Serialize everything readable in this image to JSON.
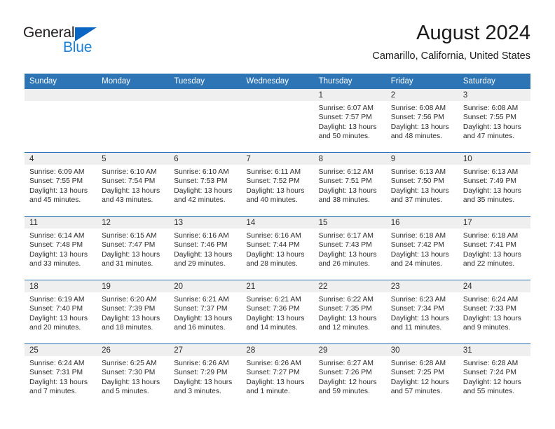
{
  "logo": {
    "word1": "General",
    "word2": "Blue",
    "triangle_color": "#0a66c2",
    "word2_color": "#1d81d7"
  },
  "header": {
    "month_title": "August 2024",
    "location": "Camarillo, California, United States"
  },
  "theme": {
    "header_bg": "#2e75b6",
    "header_text": "#ffffff",
    "daynum_band_bg": "#efefef",
    "row_separator": "#2e75b6",
    "cell_bg": "#ffffff",
    "text": "#2b2b2b"
  },
  "weekday_headers": [
    "Sunday",
    "Monday",
    "Tuesday",
    "Wednesday",
    "Thursday",
    "Friday",
    "Saturday"
  ],
  "weeks": [
    [
      {
        "day": "",
        "empty": true,
        "sunrise": "",
        "sunset": "",
        "daylight_line1": "",
        "daylight_line2": ""
      },
      {
        "day": "",
        "empty": true,
        "sunrise": "",
        "sunset": "",
        "daylight_line1": "",
        "daylight_line2": ""
      },
      {
        "day": "",
        "empty": true,
        "sunrise": "",
        "sunset": "",
        "daylight_line1": "",
        "daylight_line2": ""
      },
      {
        "day": "",
        "empty": true,
        "sunrise": "",
        "sunset": "",
        "daylight_line1": "",
        "daylight_line2": ""
      },
      {
        "day": "1",
        "empty": false,
        "sunrise": "Sunrise: 6:07 AM",
        "sunset": "Sunset: 7:57 PM",
        "daylight_line1": "Daylight: 13 hours",
        "daylight_line2": "and 50 minutes."
      },
      {
        "day": "2",
        "empty": false,
        "sunrise": "Sunrise: 6:08 AM",
        "sunset": "Sunset: 7:56 PM",
        "daylight_line1": "Daylight: 13 hours",
        "daylight_line2": "and 48 minutes."
      },
      {
        "day": "3",
        "empty": false,
        "sunrise": "Sunrise: 6:08 AM",
        "sunset": "Sunset: 7:55 PM",
        "daylight_line1": "Daylight: 13 hours",
        "daylight_line2": "and 47 minutes."
      }
    ],
    [
      {
        "day": "4",
        "empty": false,
        "sunrise": "Sunrise: 6:09 AM",
        "sunset": "Sunset: 7:55 PM",
        "daylight_line1": "Daylight: 13 hours",
        "daylight_line2": "and 45 minutes."
      },
      {
        "day": "5",
        "empty": false,
        "sunrise": "Sunrise: 6:10 AM",
        "sunset": "Sunset: 7:54 PM",
        "daylight_line1": "Daylight: 13 hours",
        "daylight_line2": "and 43 minutes."
      },
      {
        "day": "6",
        "empty": false,
        "sunrise": "Sunrise: 6:10 AM",
        "sunset": "Sunset: 7:53 PM",
        "daylight_line1": "Daylight: 13 hours",
        "daylight_line2": "and 42 minutes."
      },
      {
        "day": "7",
        "empty": false,
        "sunrise": "Sunrise: 6:11 AM",
        "sunset": "Sunset: 7:52 PM",
        "daylight_line1": "Daylight: 13 hours",
        "daylight_line2": "and 40 minutes."
      },
      {
        "day": "8",
        "empty": false,
        "sunrise": "Sunrise: 6:12 AM",
        "sunset": "Sunset: 7:51 PM",
        "daylight_line1": "Daylight: 13 hours",
        "daylight_line2": "and 38 minutes."
      },
      {
        "day": "9",
        "empty": false,
        "sunrise": "Sunrise: 6:13 AM",
        "sunset": "Sunset: 7:50 PM",
        "daylight_line1": "Daylight: 13 hours",
        "daylight_line2": "and 37 minutes."
      },
      {
        "day": "10",
        "empty": false,
        "sunrise": "Sunrise: 6:13 AM",
        "sunset": "Sunset: 7:49 PM",
        "daylight_line1": "Daylight: 13 hours",
        "daylight_line2": "and 35 minutes."
      }
    ],
    [
      {
        "day": "11",
        "empty": false,
        "sunrise": "Sunrise: 6:14 AM",
        "sunset": "Sunset: 7:48 PM",
        "daylight_line1": "Daylight: 13 hours",
        "daylight_line2": "and 33 minutes."
      },
      {
        "day": "12",
        "empty": false,
        "sunrise": "Sunrise: 6:15 AM",
        "sunset": "Sunset: 7:47 PM",
        "daylight_line1": "Daylight: 13 hours",
        "daylight_line2": "and 31 minutes."
      },
      {
        "day": "13",
        "empty": false,
        "sunrise": "Sunrise: 6:16 AM",
        "sunset": "Sunset: 7:46 PM",
        "daylight_line1": "Daylight: 13 hours",
        "daylight_line2": "and 29 minutes."
      },
      {
        "day": "14",
        "empty": false,
        "sunrise": "Sunrise: 6:16 AM",
        "sunset": "Sunset: 7:44 PM",
        "daylight_line1": "Daylight: 13 hours",
        "daylight_line2": "and 28 minutes."
      },
      {
        "day": "15",
        "empty": false,
        "sunrise": "Sunrise: 6:17 AM",
        "sunset": "Sunset: 7:43 PM",
        "daylight_line1": "Daylight: 13 hours",
        "daylight_line2": "and 26 minutes."
      },
      {
        "day": "16",
        "empty": false,
        "sunrise": "Sunrise: 6:18 AM",
        "sunset": "Sunset: 7:42 PM",
        "daylight_line1": "Daylight: 13 hours",
        "daylight_line2": "and 24 minutes."
      },
      {
        "day": "17",
        "empty": false,
        "sunrise": "Sunrise: 6:18 AM",
        "sunset": "Sunset: 7:41 PM",
        "daylight_line1": "Daylight: 13 hours",
        "daylight_line2": "and 22 minutes."
      }
    ],
    [
      {
        "day": "18",
        "empty": false,
        "sunrise": "Sunrise: 6:19 AM",
        "sunset": "Sunset: 7:40 PM",
        "daylight_line1": "Daylight: 13 hours",
        "daylight_line2": "and 20 minutes."
      },
      {
        "day": "19",
        "empty": false,
        "sunrise": "Sunrise: 6:20 AM",
        "sunset": "Sunset: 7:39 PM",
        "daylight_line1": "Daylight: 13 hours",
        "daylight_line2": "and 18 minutes."
      },
      {
        "day": "20",
        "empty": false,
        "sunrise": "Sunrise: 6:21 AM",
        "sunset": "Sunset: 7:37 PM",
        "daylight_line1": "Daylight: 13 hours",
        "daylight_line2": "and 16 minutes."
      },
      {
        "day": "21",
        "empty": false,
        "sunrise": "Sunrise: 6:21 AM",
        "sunset": "Sunset: 7:36 PM",
        "daylight_line1": "Daylight: 13 hours",
        "daylight_line2": "and 14 minutes."
      },
      {
        "day": "22",
        "empty": false,
        "sunrise": "Sunrise: 6:22 AM",
        "sunset": "Sunset: 7:35 PM",
        "daylight_line1": "Daylight: 13 hours",
        "daylight_line2": "and 12 minutes."
      },
      {
        "day": "23",
        "empty": false,
        "sunrise": "Sunrise: 6:23 AM",
        "sunset": "Sunset: 7:34 PM",
        "daylight_line1": "Daylight: 13 hours",
        "daylight_line2": "and 11 minutes."
      },
      {
        "day": "24",
        "empty": false,
        "sunrise": "Sunrise: 6:24 AM",
        "sunset": "Sunset: 7:33 PM",
        "daylight_line1": "Daylight: 13 hours",
        "daylight_line2": "and 9 minutes."
      }
    ],
    [
      {
        "day": "25",
        "empty": false,
        "sunrise": "Sunrise: 6:24 AM",
        "sunset": "Sunset: 7:31 PM",
        "daylight_line1": "Daylight: 13 hours",
        "daylight_line2": "and 7 minutes."
      },
      {
        "day": "26",
        "empty": false,
        "sunrise": "Sunrise: 6:25 AM",
        "sunset": "Sunset: 7:30 PM",
        "daylight_line1": "Daylight: 13 hours",
        "daylight_line2": "and 5 minutes."
      },
      {
        "day": "27",
        "empty": false,
        "sunrise": "Sunrise: 6:26 AM",
        "sunset": "Sunset: 7:29 PM",
        "daylight_line1": "Daylight: 13 hours",
        "daylight_line2": "and 3 minutes."
      },
      {
        "day": "28",
        "empty": false,
        "sunrise": "Sunrise: 6:26 AM",
        "sunset": "Sunset: 7:27 PM",
        "daylight_line1": "Daylight: 13 hours",
        "daylight_line2": "and 1 minute."
      },
      {
        "day": "29",
        "empty": false,
        "sunrise": "Sunrise: 6:27 AM",
        "sunset": "Sunset: 7:26 PM",
        "daylight_line1": "Daylight: 12 hours",
        "daylight_line2": "and 59 minutes."
      },
      {
        "day": "30",
        "empty": false,
        "sunrise": "Sunrise: 6:28 AM",
        "sunset": "Sunset: 7:25 PM",
        "daylight_line1": "Daylight: 12 hours",
        "daylight_line2": "and 57 minutes."
      },
      {
        "day": "31",
        "empty": false,
        "sunrise": "Sunrise: 6:28 AM",
        "sunset": "Sunset: 7:24 PM",
        "daylight_line1": "Daylight: 12 hours",
        "daylight_line2": "and 55 minutes."
      }
    ]
  ]
}
